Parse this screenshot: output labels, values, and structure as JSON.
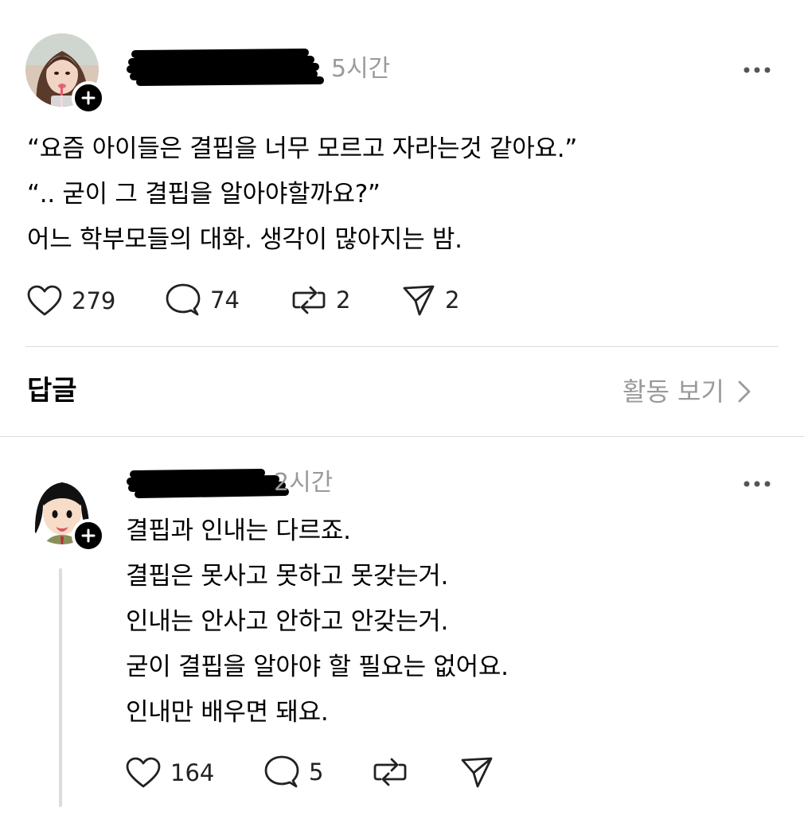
{
  "post": {
    "time": "5시간",
    "lines": [
      "“요즘 아이들은 결핍을 너무 모르고 자라는것 같아요.”",
      "“.. 굳이 그 결핍을 알아야할까요?”",
      "어느 학부모들의 대화. 생각이 많아지는 밤."
    ],
    "actions": {
      "like_count": "279",
      "comment_count": "74",
      "repost_count": "2",
      "share_count": "2"
    }
  },
  "replies_header": {
    "title": "답글",
    "activity_label": "활동 보기"
  },
  "reply": {
    "time": "2시간",
    "lines": [
      "결핍과 인내는 다르죠.",
      "결핍은 못사고 못하고 못갖는거.",
      "인내는 안사고 안하고 안갖는거.",
      "굳이 결핍을 알아야 할 필요는 없어요.",
      "인내만 배우면 돼요."
    ],
    "actions": {
      "like_count": "164",
      "comment_count": "5"
    }
  }
}
